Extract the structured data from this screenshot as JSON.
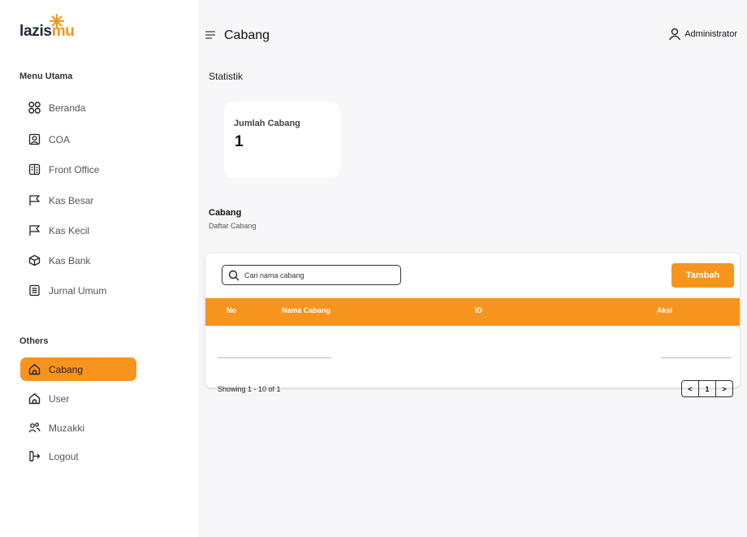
{
  "brand": {
    "logo_text_a": "lazis",
    "logo_text_b": "mu"
  },
  "sidebar": {
    "main_title": "Menu Utama",
    "main_items": [
      {
        "label": "Beranda",
        "icon": "grid-icon"
      },
      {
        "label": "COA",
        "icon": "portrait-icon"
      },
      {
        "label": "Front Office",
        "icon": "building-icon"
      },
      {
        "label": "Kas Besar",
        "icon": "flag-icon"
      },
      {
        "label": "Kas Kecil",
        "icon": "flag-icon"
      },
      {
        "label": "Kas Bank",
        "icon": "cube-icon"
      },
      {
        "label": "Jurnal Umum",
        "icon": "document-icon"
      }
    ],
    "others_title": "Others",
    "other_items": [
      {
        "label": "Cabang",
        "icon": "home-icon",
        "active": true
      },
      {
        "label": "User",
        "icon": "home-icon"
      },
      {
        "label": "Muzakki",
        "icon": "users-icon"
      },
      {
        "label": "Logout",
        "icon": "logout-icon"
      }
    ]
  },
  "header": {
    "title": "Cabang",
    "user": "Administrator"
  },
  "stats": {
    "section": "Statistik",
    "card_title": "Jumlah Cabang",
    "card_value": "1"
  },
  "list": {
    "title": "Cabang",
    "subtitle": "Daftar Cabang",
    "search_placeholder": "Cari nama cabang",
    "add_label": "Tambah",
    "columns": [
      "No",
      "Nama Cabang",
      "ID",
      "Aksi"
    ],
    "showing": "Showing 1 - 10 of 1",
    "pager": {
      "prev": "<",
      "page": "1",
      "next": ">"
    }
  },
  "colors": {
    "accent": "#f7941d",
    "background": "#f7f7f9",
    "sidebar": "#ffffff"
  }
}
